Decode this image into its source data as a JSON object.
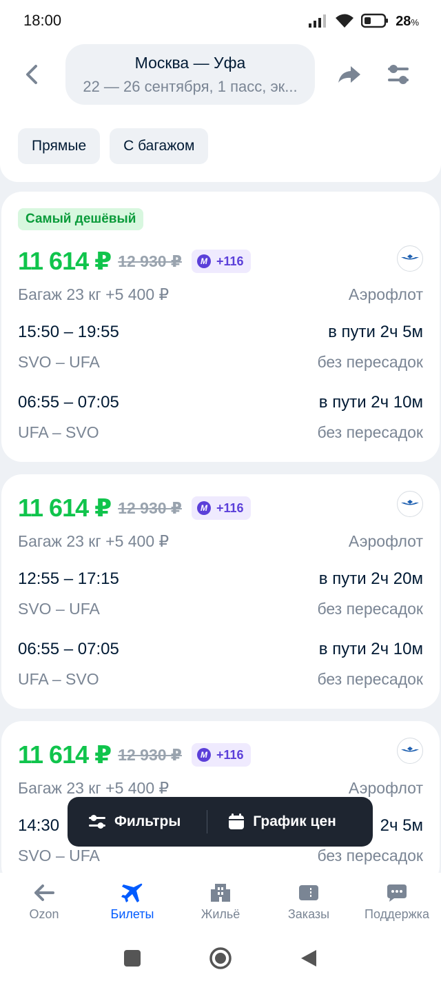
{
  "status": {
    "time": "18:00",
    "battery": "28",
    "battery_suffix": "%"
  },
  "header": {
    "route_title": "Москва — Уфа",
    "route_sub": "22 — 26 сентября, 1 пасс, эк...",
    "chips": [
      "Прямые",
      "С багажом"
    ]
  },
  "cards": [
    {
      "badge": "Самый дешёвый",
      "price": "11 614 ₽",
      "old_price": "12 930 ₽",
      "bonus": "+116",
      "baggage": "Багаж 23 кг +5 400 ₽",
      "airline": "Аэрофлот",
      "legs": [
        {
          "times": "15:50 – 19:55",
          "duration": "в пути 2ч 5м",
          "route": "SVO – UFA",
          "stops": "без пересадок"
        },
        {
          "times": "06:55 – 07:05",
          "duration": "в пути 2ч 10м",
          "route": "UFA – SVO",
          "stops": "без пересадок"
        }
      ]
    },
    {
      "price": "11 614 ₽",
      "old_price": "12 930 ₽",
      "bonus": "+116",
      "baggage": "Багаж 23 кг +5 400 ₽",
      "airline": "Аэрофлот",
      "legs": [
        {
          "times": "12:55 – 17:15",
          "duration": "в пути 2ч 20м",
          "route": "SVO – UFA",
          "stops": "без пересадок"
        },
        {
          "times": "06:55 – 07:05",
          "duration": "в пути 2ч 10м",
          "route": "UFA – SVO",
          "stops": "без пересадок"
        }
      ]
    },
    {
      "price": "11 614 ₽",
      "old_price": "12 930 ₽",
      "bonus": "+116",
      "baggage": "Багаж 23 кг +5 400 ₽",
      "airline": "Аэрофлот",
      "legs": [
        {
          "times": "14:30",
          "duration": "2ч 5м",
          "route": "SVO – UFA",
          "stops": "без пересадок"
        }
      ]
    }
  ],
  "floatbar": {
    "filters": "Фильтры",
    "price_chart": "График цен"
  },
  "nav": [
    {
      "label": "Ozon",
      "icon": "arrow-left-icon"
    },
    {
      "label": "Билеты",
      "icon": "plane-icon"
    },
    {
      "label": "Жильё",
      "icon": "building-icon"
    },
    {
      "label": "Заказы",
      "icon": "ticket-icon"
    },
    {
      "label": "Поддержка",
      "icon": "chat-icon"
    }
  ],
  "colors": {
    "accent": "#005bff",
    "price": "#10c44c",
    "bonus": "#5b3fd9",
    "floatbar": "#1e2530"
  }
}
